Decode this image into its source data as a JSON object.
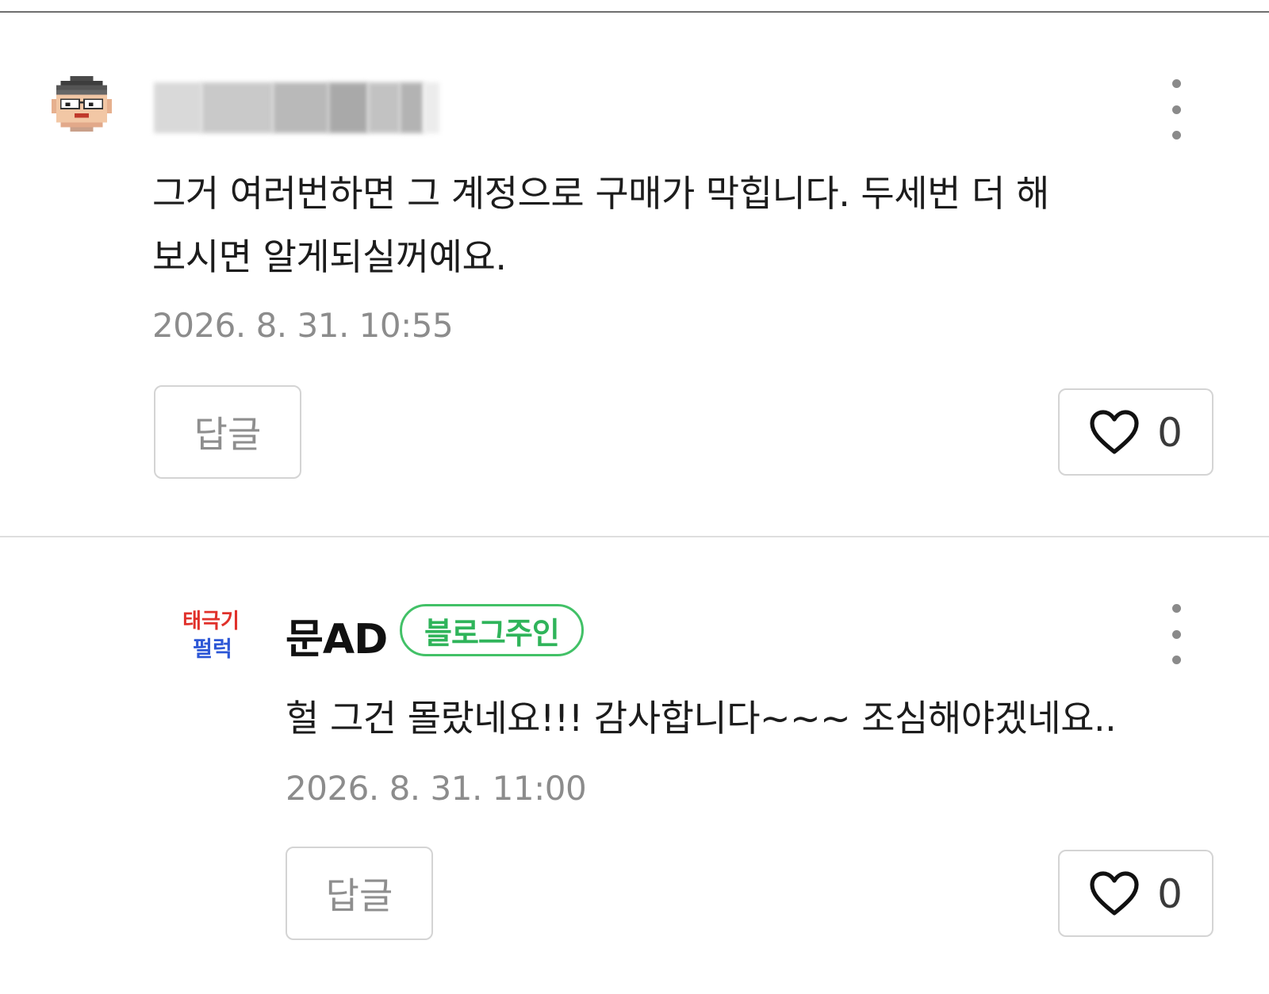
{
  "comments": [
    {
      "author_display": "",
      "avatar_icon": "pixel-person-avatar-icon",
      "text": "그거 여러번하면 그 계정으로 구매가 막힙니다. 두세번 더 해\n보시면 알게되실꺼예요.",
      "timestamp": "2026. 8. 31. 10:55",
      "reply_label": "답글",
      "like_count": "0"
    },
    {
      "author_name": "문AD",
      "badge": "블로그주인",
      "avatar_text_line1": "태극기",
      "avatar_text_line2": "펄럭",
      "text": "헐 그건 몰랐네요!!! 감사합니다~~~ 조심해야겠네요..",
      "timestamp": "2026. 8. 31. 11:00",
      "reply_label": "답글",
      "like_count": "0"
    }
  ],
  "colors": {
    "badge_green": "#42c167",
    "timestamp_gray": "#8c8c8c",
    "avatar_red": "#e0312b",
    "avatar_blue": "#2d57d6"
  }
}
